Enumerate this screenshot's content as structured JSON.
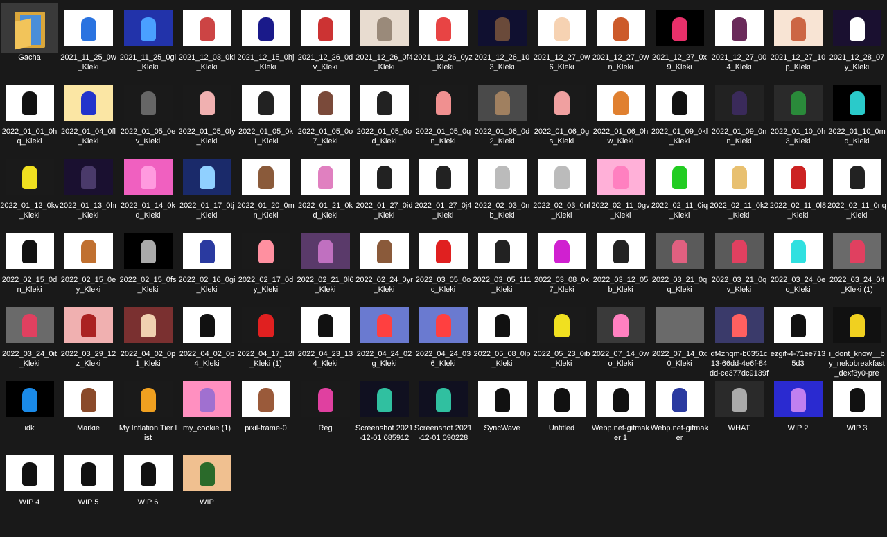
{
  "window": {
    "background": "#191919",
    "text_color": "#ffffff"
  },
  "files": [
    {
      "label": "Gacha",
      "kind": "folder",
      "icon": "folder-icon"
    },
    {
      "label": "2021_11_25_0w_Kleki",
      "bg": "#ffffff",
      "fg": "#2a73e0"
    },
    {
      "label": "2021_11_25_0gl_Kleki",
      "bg": "#2233aa",
      "fg": "#4aa0ff"
    },
    {
      "label": "2021_12_03_0ki_Kleki",
      "bg": "#ffffff",
      "fg": "#cc4444"
    },
    {
      "label": "2021_12_15_0hj_Kleki",
      "bg": "#ffffff",
      "fg": "#1a1a8a"
    },
    {
      "label": "2021_12_26_0dv_Kleki",
      "bg": "#ffffff",
      "fg": "#cc3333"
    },
    {
      "label": "2021_12_26_0f4_Kleki",
      "bg": "#e8dcd0",
      "fg": "#9a8a7a"
    },
    {
      "label": "2021_12_26_0yz_Kleki",
      "bg": "#ffffff",
      "fg": "#e84444"
    },
    {
      "label": "2021_12_26_103_Kleki",
      "bg": "#101030",
      "fg": "#6a4a3a"
    },
    {
      "label": "2021_12_27_0w6_Kleki",
      "bg": "#ffffff",
      "fg": "#f6d2b2"
    },
    {
      "label": "2021_12_27_0wn_Kleki",
      "bg": "#ffffff",
      "fg": "#cc5a2a"
    },
    {
      "label": "2021_12_27_0x9_Kleki",
      "bg": "#000000",
      "fg": "#e8306a"
    },
    {
      "label": "2021_12_27_004_Kleki",
      "bg": "#ffffff",
      "fg": "#6a2a5a"
    },
    {
      "label": "2021_12_27_10p_Kleki",
      "bg": "#f8e4d4",
      "fg": "#cc6644"
    },
    {
      "label": "2021_12_28_07y_Kleki",
      "bg": "#1a1030",
      "fg": "#ffffff"
    },
    {
      "label": "2022_01_01_0hq_Kleki",
      "bg": "#ffffff",
      "fg": "#111111"
    },
    {
      "label": "2022_01_04_0fl_Kleki",
      "bg": "#fbe6a4",
      "fg": "#2233cc"
    },
    {
      "label": "2022_01_05_0ev_Kleki",
      "bg": "#1a1a1a",
      "fg": "#666666"
    },
    {
      "label": "2022_01_05_0fy_Kleki",
      "bg": "#1a1a1a",
      "fg": "#f0b0b0"
    },
    {
      "label": "2022_01_05_0k1_Kleki",
      "bg": "#ffffff",
      "fg": "#222222"
    },
    {
      "label": "2022_01_05_0o7_Kleki",
      "bg": "#ffffff",
      "fg": "#7a4a3a"
    },
    {
      "label": "2022_01_05_0od_Kleki",
      "bg": "#ffffff",
      "fg": "#222222"
    },
    {
      "label": "2022_01_05_0qn_Kleki",
      "bg": "#1a1a1a",
      "fg": "#f09090"
    },
    {
      "label": "2022_01_06_0d2_Kleki",
      "bg": "#4a4a4a",
      "fg": "#a08060"
    },
    {
      "label": "2022_01_06_0gs_Kleki",
      "bg": "#1a1a1a",
      "fg": "#f0a0a0"
    },
    {
      "label": "2022_01_06_0hw_Kleki",
      "bg": "#ffffff",
      "fg": "#e08030"
    },
    {
      "label": "2022_01_09_0kl_Kleki",
      "bg": "#ffffff",
      "fg": "#111111"
    },
    {
      "label": "2022_01_09_0nn_Kleki",
      "bg": "#222222",
      "fg": "#3a2a5a"
    },
    {
      "label": "2022_01_10_0h3_Kleki",
      "bg": "#2a2a2a",
      "fg": "#2a8a3a"
    },
    {
      "label": "2022_01_10_0md_Kleki",
      "bg": "#000000",
      "fg": "#2acaca"
    },
    {
      "label": "2022_01_12_0kv_Kleki",
      "bg": "#1a1a1a",
      "fg": "#f0e020"
    },
    {
      "label": "2022_01_13_0hr_Kleki",
      "bg": "#1a1030",
      "fg": "#4a3a6a"
    },
    {
      "label": "2022_01_14_0kd_Kleki",
      "bg": "#f060c0",
      "fg": "#ff9adf"
    },
    {
      "label": "2022_01_17_0tj_Kleki",
      "bg": "#1a2a6a",
      "fg": "#90d0ff"
    },
    {
      "label": "2022_01_20_0mn_Kleki",
      "bg": "#ffffff",
      "fg": "#8a5a3a"
    },
    {
      "label": "2022_01_21_0kd_Kleki",
      "bg": "#ffffff",
      "fg": "#e080c0"
    },
    {
      "label": "2022_01_27_0id_Kleki",
      "bg": "#ffffff",
      "fg": "#222222"
    },
    {
      "label": "2022_01_27_0j4_Kleki",
      "bg": "#ffffff",
      "fg": "#222222"
    },
    {
      "label": "2022_02_03_0nb_Kleki",
      "bg": "#ffffff",
      "fg": "#bbbbbb"
    },
    {
      "label": "2022_02_03_0nf_Kleki",
      "bg": "#ffffff",
      "fg": "#bbbbbb"
    },
    {
      "label": "2022_02_11_0gv_Kleki",
      "bg": "#ffb0d8",
      "fg": "#ff80c0"
    },
    {
      "label": "2022_02_11_0iq_Kleki",
      "bg": "#ffffff",
      "fg": "#22cc22"
    },
    {
      "label": "2022_02_11_0k2_Kleki",
      "bg": "#ffffff",
      "fg": "#e8c070"
    },
    {
      "label": "2022_02_11_0l8_Kleki",
      "bg": "#ffffff",
      "fg": "#cc2222"
    },
    {
      "label": "2022_02_11_0nq_Kleki",
      "bg": "#ffffff",
      "fg": "#222222"
    },
    {
      "label": "2022_02_15_0dn_Kleki",
      "bg": "#ffffff",
      "fg": "#111111"
    },
    {
      "label": "2022_02_15_0ey_Kleki",
      "bg": "#ffffff",
      "fg": "#c07030"
    },
    {
      "label": "2022_02_15_0fs_Kleki",
      "bg": "#000000",
      "fg": "#aaaaaa"
    },
    {
      "label": "2022_02_16_0gi_Kleki",
      "bg": "#ffffff",
      "fg": "#2a3aa0"
    },
    {
      "label": "2022_02_17_0dy_Kleki",
      "bg": "#1a1a1a",
      "fg": "#ff90a0"
    },
    {
      "label": "2022_02_21_0l6_Kleki",
      "bg": "#5a3a6a",
      "fg": "#c070c0"
    },
    {
      "label": "2022_02_24_0yr_Kleki",
      "bg": "#ffffff",
      "fg": "#8a5a3a"
    },
    {
      "label": "2022_03_05_0oc_Kleki",
      "bg": "#ffffff",
      "fg": "#e02020"
    },
    {
      "label": "2022_03_05_111_Kleki",
      "bg": "#ffffff",
      "fg": "#222222"
    },
    {
      "label": "2022_03_08_0x7_Kleki",
      "bg": "#ffffff",
      "fg": "#d020d0"
    },
    {
      "label": "2022_03_12_05b_Kleki",
      "bg": "#ffffff",
      "fg": "#222222"
    },
    {
      "label": "2022_03_21_0qq_Kleki",
      "bg": "#5a5a5a",
      "fg": "#e06080"
    },
    {
      "label": "2022_03_21_0qv_Kleki",
      "bg": "#5a5a5a",
      "fg": "#e04060"
    },
    {
      "label": "2022_03_24_0eo_Kleki",
      "bg": "#ffffff",
      "fg": "#30e0e0"
    },
    {
      "label": "2022_03_24_0it_Kleki (1)",
      "bg": "#6a6a6a",
      "fg": "#e04060"
    },
    {
      "label": "2022_03_24_0it_Kleki",
      "bg": "#6a6a6a",
      "fg": "#e04060"
    },
    {
      "label": "2022_03_29_12z_Kleki",
      "bg": "#f0b0b0",
      "fg": "#aa2222"
    },
    {
      "label": "2022_04_02_0p1_Kleki",
      "bg": "#7a3030",
      "fg": "#f0d0b0"
    },
    {
      "label": "2022_04_02_0p4_Kleki",
      "bg": "#ffffff",
      "fg": "#111111"
    },
    {
      "label": "2022_04_17_12l_Kleki (1)",
      "bg": "#1a1a1a",
      "fg": "#e02020"
    },
    {
      "label": "2022_04_23_134_Kleki",
      "bg": "#ffffff",
      "fg": "#111111"
    },
    {
      "label": "2022_04_24_02g_Kleki",
      "bg": "#6a7ad0",
      "fg": "#ff4040"
    },
    {
      "label": "2022_04_24_036_Kleki",
      "bg": "#6a7ad0",
      "fg": "#ff4040"
    },
    {
      "label": "2022_05_08_0lp_Kleki",
      "bg": "#ffffff",
      "fg": "#111111"
    },
    {
      "label": "2022_05_23_0ib_Kleki",
      "bg": "#1a1a1a",
      "fg": "#f0e020"
    },
    {
      "label": "2022_07_14_0wo_Kleki",
      "bg": "#3a3a3a",
      "fg": "#ff80c0"
    },
    {
      "label": "2022_07_14_0x0_Kleki",
      "bg": "#6a6a6a",
      "fg": "#6a6a6a"
    },
    {
      "label": "df4znqm-b0351c13-66dd-4e6f-84dd-ce377dc9139f",
      "bg": "#3a3a6a",
      "fg": "#ff6060"
    },
    {
      "label": "ezgif-4-71ee7135d3",
      "bg": "#ffffff",
      "fg": "#111111"
    },
    {
      "label": "i_dont_know__by_nekobreakfast_dexf3y0-pre",
      "bg": "#111111",
      "fg": "#f0d020"
    },
    {
      "label": "idk",
      "bg": "#000000",
      "fg": "#1a8ae8"
    },
    {
      "label": "Markie",
      "bg": "#ffffff",
      "fg": "#8a4a2a"
    },
    {
      "label": "My Inflation Tier list",
      "bg": "#1a1a1a",
      "fg": "#f0a020"
    },
    {
      "label": "my_cookie (1)",
      "bg": "#ff90c0",
      "fg": "#a070d0"
    },
    {
      "label": "pixil-frame-0",
      "bg": "#ffffff",
      "fg": "#9a5a3a"
    },
    {
      "label": "Reg",
      "bg": "#1a1a1a",
      "fg": "#e040a0"
    },
    {
      "label": "Screenshot 2021-12-01 085912",
      "bg": "#101020",
      "fg": "#30c0a0"
    },
    {
      "label": "Screenshot 2021-12-01 090228",
      "bg": "#101020",
      "fg": "#30c0a0"
    },
    {
      "label": "SyncWave",
      "bg": "#ffffff",
      "fg": "#111111"
    },
    {
      "label": "Untitled",
      "bg": "#ffffff",
      "fg": "#111111"
    },
    {
      "label": "Webp.net-gifmaker 1",
      "bg": "#ffffff",
      "fg": "#111111"
    },
    {
      "label": "Webp.net-gifmaker",
      "bg": "#ffffff",
      "fg": "#2a3aa0"
    },
    {
      "label": "WHAT",
      "bg": "#2a2a2a",
      "fg": "#aaaaaa"
    },
    {
      "label": "WIP 2",
      "bg": "#2a2ad0",
      "fg": "#c080f0"
    },
    {
      "label": "WIP 3",
      "bg": "#ffffff",
      "fg": "#111111"
    },
    {
      "label": "WIP 4",
      "bg": "#ffffff",
      "fg": "#111111"
    },
    {
      "label": "WIP 5",
      "bg": "#ffffff",
      "fg": "#111111"
    },
    {
      "label": "WIP 6",
      "bg": "#ffffff",
      "fg": "#111111"
    },
    {
      "label": "WIP",
      "bg": "#f0c090",
      "fg": "#2a6a2a"
    }
  ]
}
